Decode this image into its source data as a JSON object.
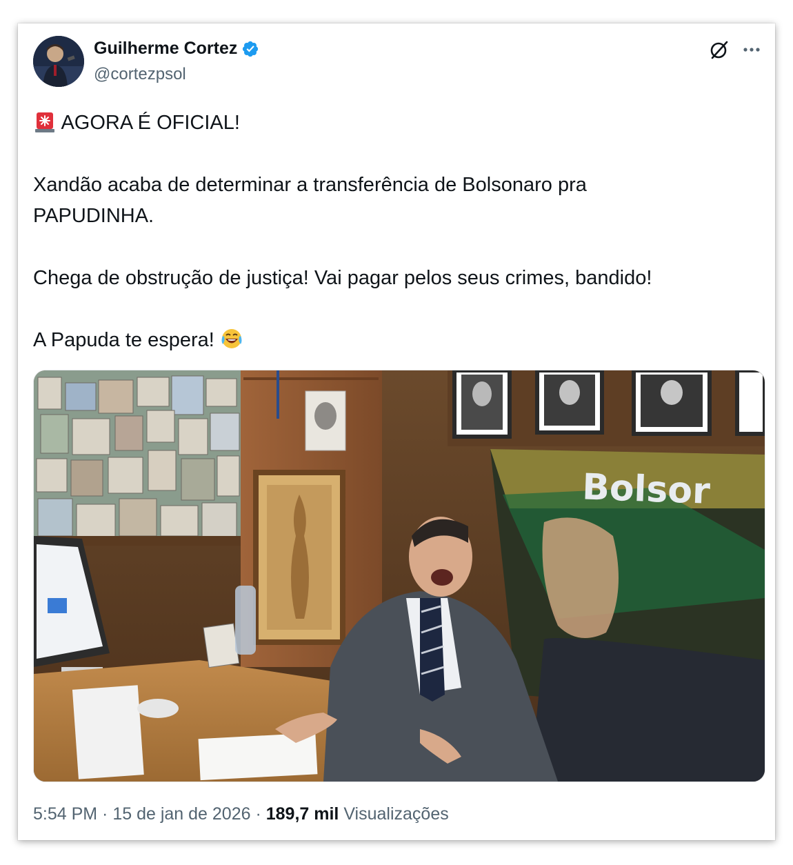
{
  "author": {
    "display_name": "Guilherme Cortez",
    "handle": "@cortezpsol",
    "verified": true
  },
  "icons": {
    "verified": "verified-badge-icon",
    "grok": "grok-icon",
    "more": "more-options-icon",
    "siren": "rotating-light-emoji",
    "laugh": "face-with-tears-of-joy-emoji"
  },
  "colors": {
    "verified": "#1d9bf0",
    "text": "#0f1419",
    "secondary": "#536471"
  },
  "tweet": {
    "line1": "AGORA É OFICIAL!",
    "line2": "Xandão acaba de determinar a transferência de Bolsonaro pra",
    "line3": "PAPUDINHA.",
    "line4": "Chega de obstrução de justiça! Vai pagar pelos seus crimes, bandido!",
    "line5": "A Papuda te espera!"
  },
  "media": {
    "banner_text": "Bolsor"
  },
  "footer": {
    "time": "5:54 PM",
    "separator": " · ",
    "date": "15 de jan de 2026",
    "views_count": "189,7 mil",
    "views_label": "Visualizações"
  }
}
